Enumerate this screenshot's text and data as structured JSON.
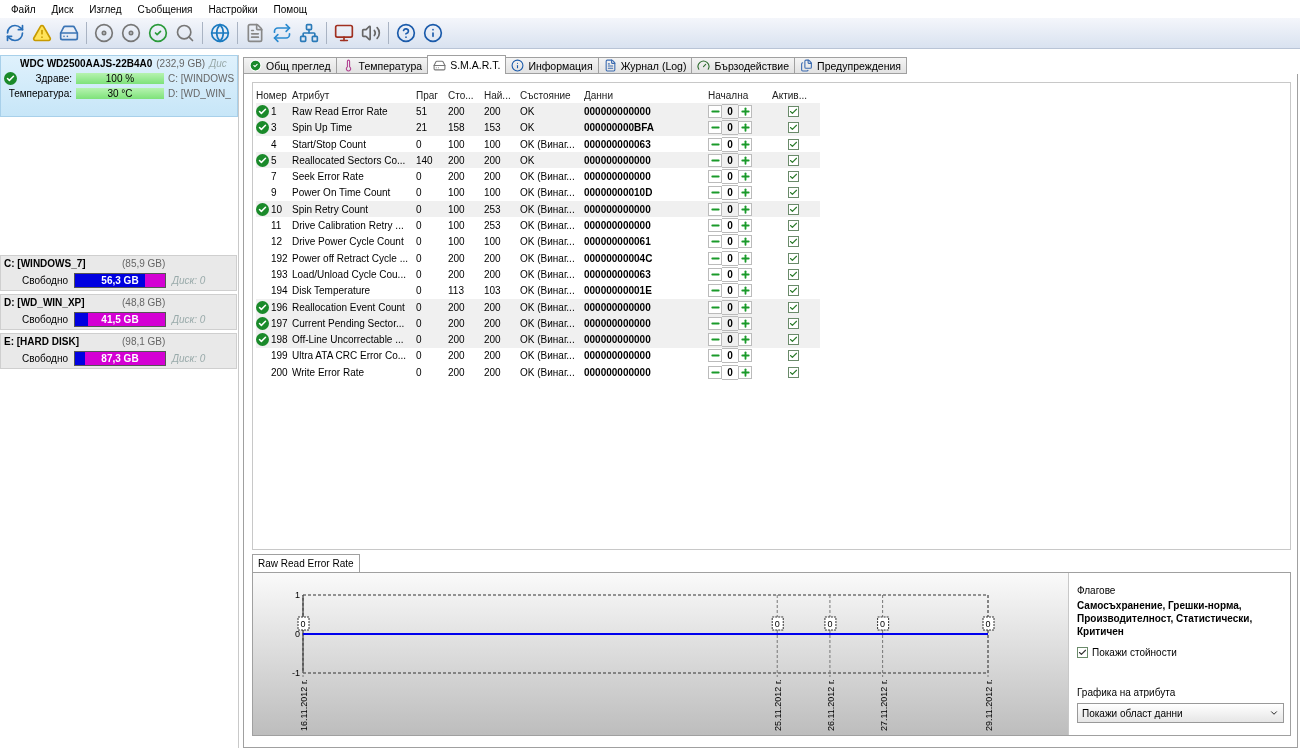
{
  "menu": [
    "Файл",
    "Диск",
    "Изглед",
    "Съобщения",
    "Настройки",
    "Помощ"
  ],
  "toolbar": [
    {
      "kind": "refresh"
    },
    {
      "kind": "warning"
    },
    {
      "kind": "drive"
    },
    {
      "kind": "sep"
    },
    {
      "kind": "disk"
    },
    {
      "kind": "disk"
    },
    {
      "kind": "disk-ok"
    },
    {
      "kind": "disk-search"
    },
    {
      "kind": "sep"
    },
    {
      "kind": "globe"
    },
    {
      "kind": "sep"
    },
    {
      "kind": "doc"
    },
    {
      "kind": "sync"
    },
    {
      "kind": "network"
    },
    {
      "kind": "sep"
    },
    {
      "kind": "monitor"
    },
    {
      "kind": "speaker"
    },
    {
      "kind": "sep"
    },
    {
      "kind": "help"
    },
    {
      "kind": "info"
    }
  ],
  "disk": {
    "model": "WDC WD2500AAJS-22B4A0",
    "size": "(232,9 GB)",
    "disk_label": "Дис",
    "health_label": "Здраве:",
    "health": {
      "value": "100 %",
      "level": 1
    },
    "temp_label": "Температура:",
    "temp": {
      "value": "30 °C",
      "level": 1
    },
    "part_c": "C: [WINDOWS",
    "part_d": "D: [WD_WIN_"
  },
  "partitions": [
    {
      "name": "C: [WINDOWS_7]",
      "size": "(85,9 GB)",
      "free_label": "Свободно",
      "free": "56,3 GB",
      "level": 0.78,
      "disk": "Диск: 0"
    },
    {
      "name": "D: [WD_WIN_XP]",
      "size": "(48,8 GB)",
      "free_label": "Свободно",
      "free": "41,5 GB",
      "level": 0.15,
      "disk": "Диск: 0"
    },
    {
      "name": "E: [HARD DISK]",
      "size": "(98,1 GB)",
      "free_label": "Свободно",
      "free": "87,3 GB",
      "level": 0.11,
      "disk": "Диск: 0"
    }
  ],
  "tabs": [
    {
      "label": "Общ преглед",
      "kind": "ok",
      "selected": false
    },
    {
      "label": "Температура",
      "kind": "thermo",
      "selected": false
    },
    {
      "label": "S.M.A.R.T.",
      "kind": "drive",
      "selected": true
    },
    {
      "label": "Информация",
      "kind": "info",
      "selected": false
    },
    {
      "label": "Журнал (Log)",
      "kind": "doc",
      "selected": false
    },
    {
      "label": "Бързодействие",
      "kind": "gauge",
      "selected": false
    },
    {
      "label": "Предупреждения",
      "kind": "pages",
      "selected": false
    }
  ],
  "table": {
    "columns": [
      "Номер",
      "Атрибут",
      "Праг",
      "Сто...",
      "Най...",
      "Състояние",
      "Данни",
      "Начална",
      "Актив..."
    ],
    "rows": [
      {
        "id": "1",
        "attribute": "Raw Read Error Rate",
        "threshold": "51",
        "value": "200",
        "worst": "200",
        "status": "OK",
        "data": "000000000000",
        "initial": "0",
        "critical": true,
        "active": true
      },
      {
        "id": "3",
        "attribute": "Spin Up Time",
        "threshold": "21",
        "value": "158",
        "worst": "153",
        "status": "OK",
        "data": "000000000BFA",
        "initial": "0",
        "critical": true,
        "active": true
      },
      {
        "id": "4",
        "attribute": "Start/Stop Count",
        "threshold": "0",
        "value": "100",
        "worst": "100",
        "status": "OK (Винаг...",
        "data": "000000000063",
        "initial": "0",
        "critical": false,
        "active": true
      },
      {
        "id": "5",
        "attribute": "Reallocated Sectors Co...",
        "threshold": "140",
        "value": "200",
        "worst": "200",
        "status": "OK",
        "data": "000000000000",
        "initial": "0",
        "critical": true,
        "active": true
      },
      {
        "id": "7",
        "attribute": "Seek Error Rate",
        "threshold": "0",
        "value": "200",
        "worst": "200",
        "status": "OK (Винаг...",
        "data": "000000000000",
        "initial": "0",
        "critical": false,
        "active": true
      },
      {
        "id": "9",
        "attribute": "Power On Time Count",
        "threshold": "0",
        "value": "100",
        "worst": "100",
        "status": "OK (Винаг...",
        "data": "00000000010D",
        "initial": "0",
        "critical": false,
        "active": true
      },
      {
        "id": "10",
        "attribute": "Spin Retry Count",
        "threshold": "0",
        "value": "100",
        "worst": "253",
        "status": "OK (Винаг...",
        "data": "000000000000",
        "initial": "0",
        "critical": true,
        "active": true
      },
      {
        "id": "11",
        "attribute": "Drive Calibration Retry ...",
        "threshold": "0",
        "value": "100",
        "worst": "253",
        "status": "OK (Винаг...",
        "data": "000000000000",
        "initial": "0",
        "critical": false,
        "active": true
      },
      {
        "id": "12",
        "attribute": "Drive Power Cycle Count",
        "threshold": "0",
        "value": "100",
        "worst": "100",
        "status": "OK (Винаг...",
        "data": "000000000061",
        "initial": "0",
        "critical": false,
        "active": true
      },
      {
        "id": "192",
        "attribute": "Power off Retract Cycle ...",
        "threshold": "0",
        "value": "200",
        "worst": "200",
        "status": "OK (Винаг...",
        "data": "00000000004C",
        "initial": "0",
        "critical": false,
        "active": true
      },
      {
        "id": "193",
        "attribute": "Load/Unload Cycle Cou...",
        "threshold": "0",
        "value": "200",
        "worst": "200",
        "status": "OK (Винаг...",
        "data": "000000000063",
        "initial": "0",
        "critical": false,
        "active": true
      },
      {
        "id": "194",
        "attribute": "Disk Temperature",
        "threshold": "0",
        "value": "113",
        "worst": "103",
        "status": "OK (Винаг...",
        "data": "00000000001E",
        "initial": "0",
        "critical": false,
        "active": true
      },
      {
        "id": "196",
        "attribute": "Reallocation Event Count",
        "threshold": "0",
        "value": "200",
        "worst": "200",
        "status": "OK (Винаг...",
        "data": "000000000000",
        "initial": "0",
        "critical": true,
        "active": true
      },
      {
        "id": "197",
        "attribute": "Current Pending Sector...",
        "threshold": "0",
        "value": "200",
        "worst": "200",
        "status": "OK (Винаг...",
        "data": "000000000000",
        "initial": "0",
        "critical": true,
        "active": true
      },
      {
        "id": "198",
        "attribute": "Off-Line Uncorrectable ...",
        "threshold": "0",
        "value": "200",
        "worst": "200",
        "status": "OK (Винаг...",
        "data": "000000000000",
        "initial": "0",
        "critical": true,
        "active": true
      },
      {
        "id": "199",
        "attribute": "Ultra ATA CRC Error Co...",
        "threshold": "0",
        "value": "200",
        "worst": "200",
        "status": "OK (Винаг...",
        "data": "000000000000",
        "initial": "0",
        "critical": false,
        "active": true
      },
      {
        "id": "200",
        "attribute": "Write Error Rate",
        "threshold": "0",
        "value": "200",
        "worst": "200",
        "status": "OK (Винаг...",
        "data": "000000000000",
        "initial": "0",
        "critical": false,
        "active": true
      }
    ]
  },
  "graph_tab": "Raw Read Error Rate",
  "chart_data": {
    "type": "line",
    "grid": true,
    "categories": [
      "16.11.2012 г.",
      "25.11.2012 г.",
      "26.11.2012 г.",
      "27.11.2012 г.",
      "29.11.2012 г."
    ],
    "ylim": [
      -1,
      1
    ],
    "yticks": [
      -1,
      0,
      1
    ],
    "data_labels": true,
    "series": [
      {
        "color": "#0000ee",
        "values": [
          0,
          0,
          0,
          0,
          0
        ]
      }
    ]
  },
  "flags": {
    "label": "Флагове",
    "value": "Самосъхранение, Грешки-норма, Производителност, Статистически, Критичен"
  },
  "show_values": {
    "label": "Покажи стойности",
    "checked": true
  },
  "graph_mode": {
    "label": "Графика на атрибута",
    "value": "Покажи област данни"
  }
}
